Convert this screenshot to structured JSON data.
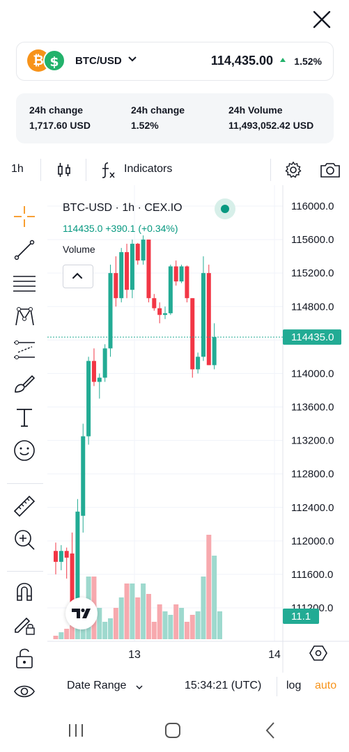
{
  "header": {
    "pair": "BTC/USD",
    "price": "114,435.00",
    "change_pct": "1.52%",
    "coin1_symbol": "₿",
    "coin2_symbol": "$"
  },
  "stats": [
    {
      "label": "24h change",
      "value": "1,717.60 USD"
    },
    {
      "label": "24h change",
      "value": "1.52%"
    },
    {
      "label": "24h Volume",
      "value": "11,493,052.42 USD"
    }
  ],
  "toolbar": {
    "interval": "1h",
    "indicators_label": "Indicators"
  },
  "chart": {
    "legend_title": "BTC-USD · 1h · CEX.IO",
    "legend_values": "114435.0  +390.1 (+0.34%)",
    "volume_label": "Volume",
    "price_axis": [
      "116000.0",
      "115600.0",
      "115200.0",
      "114800.0",
      "114400.0",
      "114000.0",
      "113600.0",
      "113200.0",
      "112800.0",
      "112400.0",
      "112000.0",
      "111600.0",
      "111200.0"
    ],
    "current_price_tag": "114435.0",
    "volume_tag": "11.1",
    "time_axis": [
      "13",
      "14"
    ],
    "colors": {
      "up": "#22ab94",
      "down": "#f23645",
      "vol_up": "#9ed9ce",
      "vol_down": "#f7a9ae"
    }
  },
  "chart_data": {
    "type": "candlestick",
    "title": "BTC-USD · 1h · CEX.IO",
    "ylim": [
      111100,
      116150
    ],
    "candles": [
      {
        "o": 111880,
        "h": 111980,
        "l": 111600,
        "c": 111750
      },
      {
        "o": 111750,
        "h": 111950,
        "l": 111650,
        "c": 111880
      },
      {
        "o": 111880,
        "h": 111920,
        "l": 111550,
        "c": 111800
      },
      {
        "o": 111850,
        "h": 112100,
        "l": 111150,
        "c": 111200
      },
      {
        "o": 111200,
        "h": 112500,
        "l": 111050,
        "c": 112350
      },
      {
        "o": 112300,
        "h": 113400,
        "l": 112100,
        "c": 113250
      },
      {
        "o": 113250,
        "h": 114200,
        "l": 113150,
        "c": 114150
      },
      {
        "o": 114150,
        "h": 114300,
        "l": 113850,
        "c": 113900
      },
      {
        "o": 113900,
        "h": 114000,
        "l": 113700,
        "c": 113950
      },
      {
        "o": 113950,
        "h": 114350,
        "l": 113900,
        "c": 114300
      },
      {
        "o": 114300,
        "h": 115300,
        "l": 114200,
        "c": 115200
      },
      {
        "o": 115200,
        "h": 115400,
        "l": 114800,
        "c": 114900
      },
      {
        "o": 114900,
        "h": 115500,
        "l": 114850,
        "c": 115450
      },
      {
        "o": 115450,
        "h": 115550,
        "l": 114900,
        "c": 115000
      },
      {
        "o": 115000,
        "h": 115600,
        "l": 114900,
        "c": 115550
      },
      {
        "o": 115550,
        "h": 115560,
        "l": 115300,
        "c": 115350
      },
      {
        "o": 115350,
        "h": 115650,
        "l": 115300,
        "c": 115600
      },
      {
        "o": 115600,
        "h": 115600,
        "l": 114850,
        "c": 114900
      },
      {
        "o": 114900,
        "h": 114950,
        "l": 114750,
        "c": 114780
      },
      {
        "o": 114780,
        "h": 114850,
        "l": 114600,
        "c": 114700
      },
      {
        "o": 114700,
        "h": 114800,
        "l": 114650,
        "c": 114720
      },
      {
        "o": 114720,
        "h": 115300,
        "l": 114700,
        "c": 115280
      },
      {
        "o": 115280,
        "h": 115350,
        "l": 115050,
        "c": 115100
      },
      {
        "o": 115100,
        "h": 115300,
        "l": 115080,
        "c": 115280
      },
      {
        "o": 115280,
        "h": 115290,
        "l": 114850,
        "c": 114900
      },
      {
        "o": 114900,
        "h": 114900,
        "l": 113950,
        "c": 114050
      },
      {
        "o": 114050,
        "h": 114250,
        "l": 114000,
        "c": 114200
      },
      {
        "o": 114200,
        "h": 115400,
        "l": 114150,
        "c": 115200
      },
      {
        "o": 115200,
        "h": 115300,
        "l": 114100,
        "c": 114100
      },
      {
        "o": 114100,
        "h": 114600,
        "l": 114050,
        "c": 114435
      }
    ],
    "volume": [
      1,
      2,
      3,
      4,
      4,
      6,
      18,
      18,
      9,
      5,
      6,
      9,
      12,
      16,
      16,
      12,
      16,
      13,
      5,
      10,
      8,
      7,
      10,
      9,
      5,
      7,
      8,
      18,
      30,
      24,
      8
    ]
  },
  "bottom": {
    "date_range": "Date Range",
    "time": "15:34:21 (UTC)",
    "log": "log",
    "auto": "auto"
  }
}
